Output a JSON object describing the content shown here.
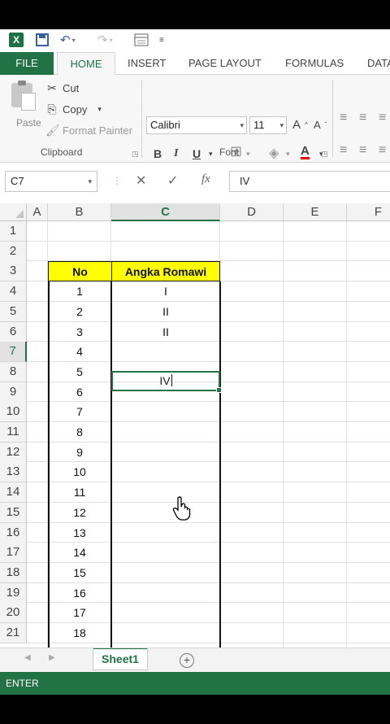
{
  "window": {
    "app_icon_letter": "X"
  },
  "qat": {
    "icons": [
      "excel-logo",
      "save-icon",
      "undo-icon",
      "redo-icon",
      "form-icon",
      "customize-icon"
    ]
  },
  "tabs": [
    {
      "label": "FILE"
    },
    {
      "label": "HOME"
    },
    {
      "label": "INSERT"
    },
    {
      "label": "PAGE LAYOUT"
    },
    {
      "label": "FORMULAS"
    },
    {
      "label": "DATA"
    }
  ],
  "ribbon": {
    "clipboard": {
      "paste": "Paste",
      "cut": "Cut",
      "copy": "Copy",
      "format_painter": "Format Painter",
      "group_label": "Clipboard"
    },
    "font": {
      "font_name": "Calibri",
      "font_size": "11",
      "bold": "B",
      "italic": "I",
      "underline": "U",
      "grow": "A",
      "shrink": "A",
      "font_color": "A",
      "group_label": "Font"
    }
  },
  "formula_bar": {
    "name_box": "C7",
    "cancel": "✕",
    "enter": "✓",
    "fx": "fx",
    "value": "IV"
  },
  "grid": {
    "columns": [
      "A",
      "B",
      "C",
      "D",
      "E",
      "F"
    ],
    "selected_column": "C",
    "rows": [
      "1",
      "2",
      "3",
      "4",
      "5",
      "6",
      "7",
      "8",
      "9",
      "10",
      "11",
      "12",
      "13",
      "14",
      "15",
      "16",
      "17",
      "18",
      "19",
      "20",
      "21"
    ],
    "selected_row": "7",
    "header": {
      "no": "No",
      "roman": "Angka Romawi"
    },
    "numbers": [
      "1",
      "2",
      "3",
      "4",
      "5",
      "6",
      "7",
      "8",
      "9",
      "10",
      "11",
      "12",
      "13",
      "14",
      "15",
      "16",
      "17",
      "18"
    ],
    "romans": [
      "I",
      "II",
      "II",
      "IV"
    ]
  },
  "sheets": [
    {
      "label": "Sheet1"
    }
  ],
  "add_sheet": "+",
  "status": {
    "mode": "ENTER"
  },
  "colors": {
    "accent": "#217346",
    "header_fill": "#ffff00"
  }
}
